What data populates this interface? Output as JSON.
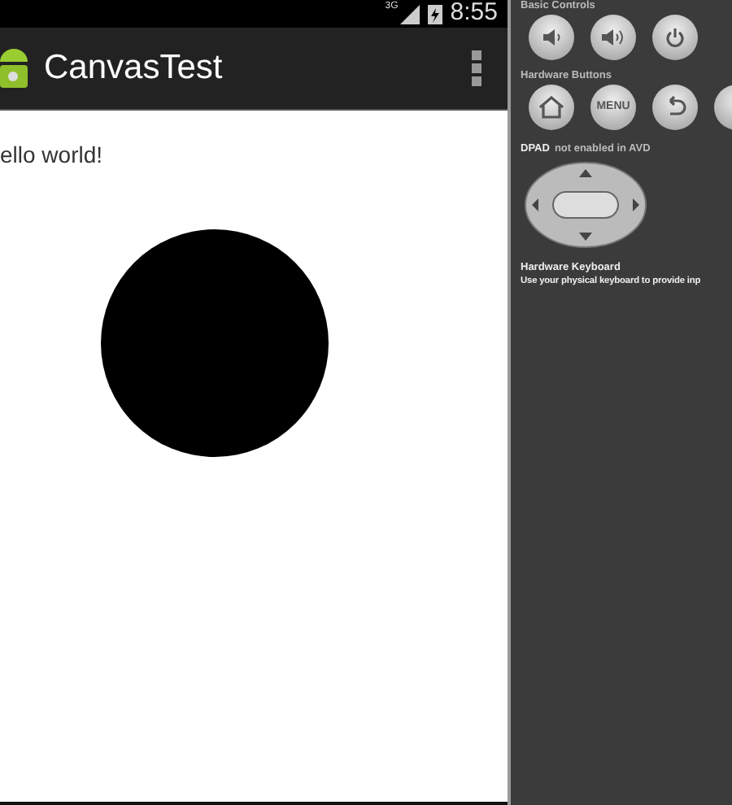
{
  "status_bar": {
    "network": "3G",
    "time": "8:55"
  },
  "action_bar": {
    "title": "CanvasTest"
  },
  "content": {
    "text": "ello world!"
  },
  "controls_panel": {
    "sections": [
      {
        "kind": "buttons",
        "label": "Basic Controls",
        "buttons": [
          {
            "kind": "volume-down"
          },
          {
            "kind": "volume-up"
          },
          {
            "kind": "power"
          }
        ]
      },
      {
        "kind": "buttons",
        "label": "Hardware Buttons",
        "buttons": [
          {
            "kind": "home"
          },
          {
            "kind": "text",
            "label": "MENU"
          },
          {
            "kind": "back"
          },
          {
            "kind": "partial"
          }
        ]
      },
      {
        "kind": "dpad",
        "label": "DPAD",
        "note": "not enabled in AVD"
      },
      {
        "kind": "info",
        "label": "Hardware Keyboard",
        "note": "Use your physical keyboard to provide inp"
      }
    ]
  }
}
